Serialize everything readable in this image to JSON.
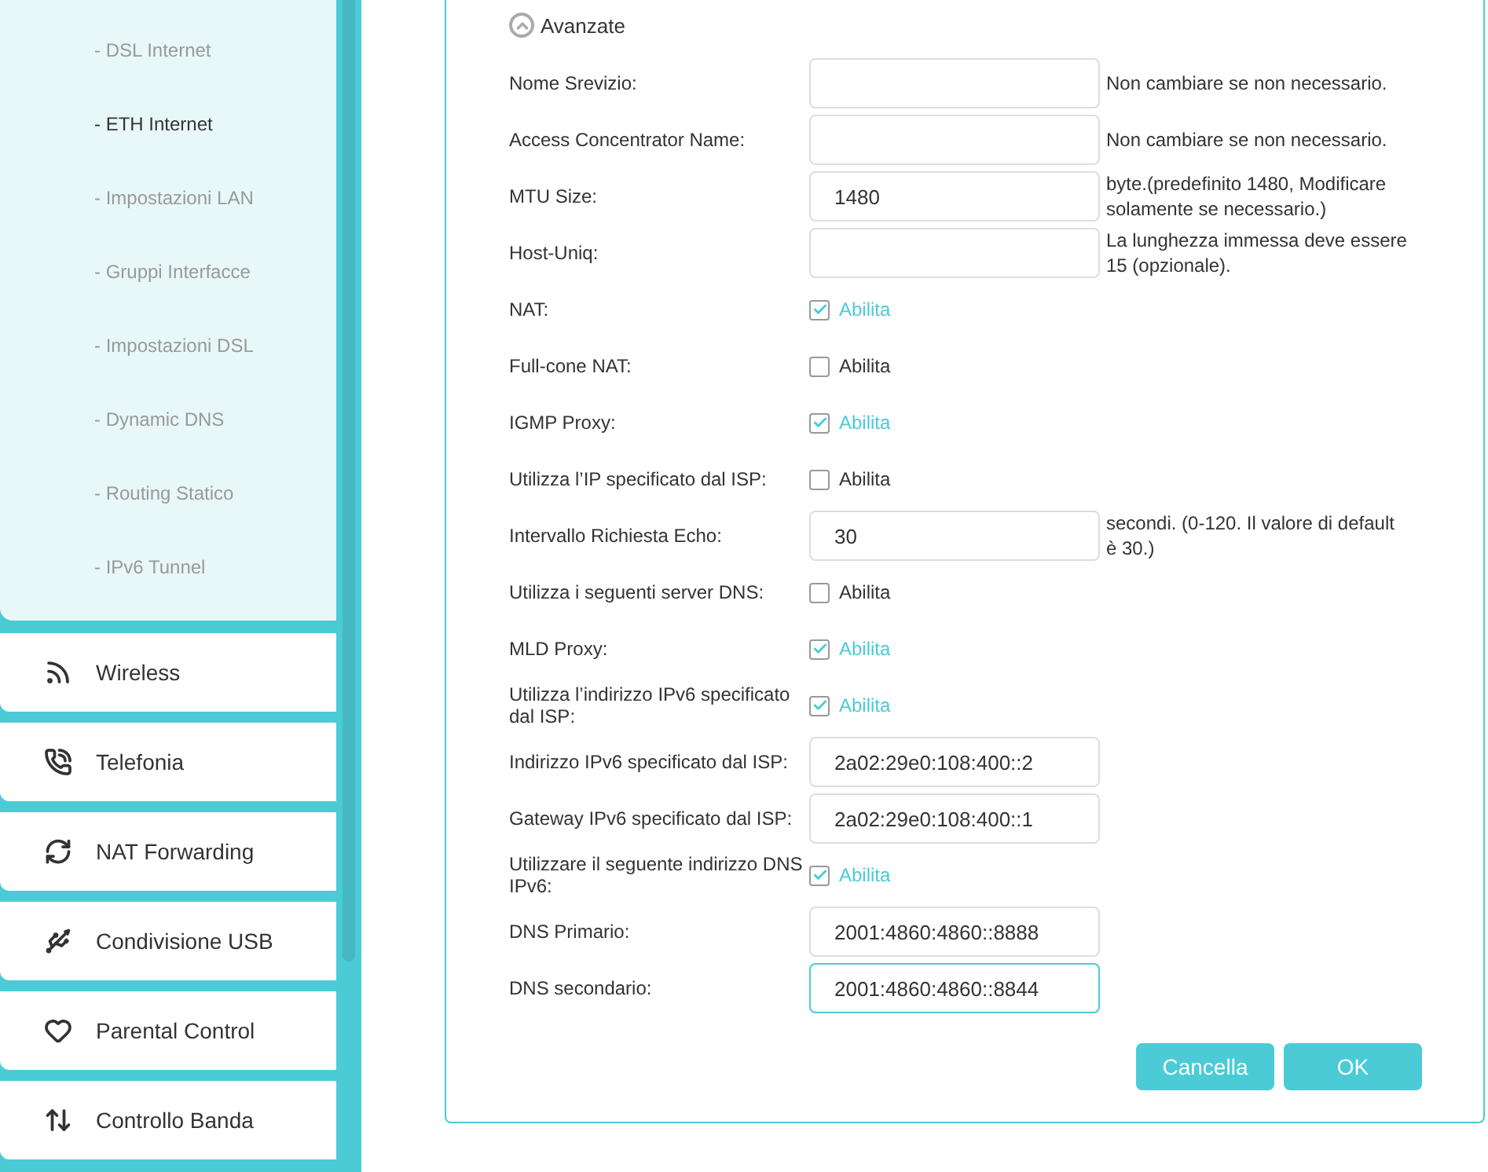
{
  "sidebar": {
    "submenu": [
      {
        "label": "- DSL Internet",
        "selected": false
      },
      {
        "label": "- ETH Internet",
        "selected": true
      },
      {
        "label": "- Impostazioni LAN",
        "selected": false
      },
      {
        "label": "- Gruppi Interfacce",
        "selected": false
      },
      {
        "label": "- Impostazioni DSL",
        "selected": false
      },
      {
        "label": "- Dynamic DNS",
        "selected": false
      },
      {
        "label": "- Routing Statico",
        "selected": false
      },
      {
        "label": "- IPv6 Tunnel",
        "selected": false
      }
    ],
    "menu": [
      {
        "label": "Wireless"
      },
      {
        "label": "Telefonia"
      },
      {
        "label": "NAT Forwarding"
      },
      {
        "label": "Condivisione USB"
      },
      {
        "label": "Parental Control"
      },
      {
        "label": "Controllo Banda"
      }
    ]
  },
  "form": {
    "section": "Avanzate",
    "expanded": true,
    "rows": [
      {
        "kind": "input",
        "label": "Nome Srevizio:",
        "note": "Non cambiare se non necessario.",
        "focused": false
      },
      {
        "kind": "input",
        "label": "Access Concentrator Name:",
        "note": "Non cambiare se non necessario.",
        "focused": false
      },
      {
        "kind": "input",
        "label": "MTU Size:",
        "value": "1480",
        "note": "byte.(predefinito 1480, Modificare solamente se necessario.)",
        "focused": false
      },
      {
        "kind": "input",
        "label": "Host-Uniq:",
        "note": "La lunghezza immessa deve essere 15 (opzionale).",
        "focused": false
      },
      {
        "kind": "checkbox",
        "label": "NAT:",
        "option": "Abilita",
        "checked": true
      },
      {
        "kind": "checkbox",
        "label": "Full-cone NAT:",
        "option": "Abilita",
        "checked": false
      },
      {
        "kind": "checkbox",
        "label": "IGMP Proxy:",
        "option": "Abilita",
        "checked": true
      },
      {
        "kind": "checkbox",
        "label": "Utilizza l’IP specificato dal ISP:",
        "option": "Abilita",
        "checked": false
      },
      {
        "kind": "input",
        "label": "Intervallo Richiesta Echo:",
        "value": "30",
        "note": "secondi. (0-120. Il valore di default è 30.)",
        "focused": false
      },
      {
        "kind": "checkbox",
        "label": "Utilizza i seguenti server DNS:",
        "option": "Abilita",
        "checked": false
      },
      {
        "kind": "checkbox",
        "label": "MLD Proxy:",
        "option": "Abilita",
        "checked": true
      },
      {
        "kind": "checkbox",
        "label": "Utilizza l’indirizzo IPv6 specificato dal ISP:",
        "option": "Abilita",
        "checked": true
      },
      {
        "kind": "input",
        "label": "Indirizzo IPv6 specificato dal ISP:",
        "value": "2a02:29e0:108:400::2",
        "focused": false
      },
      {
        "kind": "input",
        "label": "Gateway IPv6 specificato dal ISP:",
        "value": "2a02:29e0:108:400::1",
        "focused": false
      },
      {
        "kind": "checkbox",
        "label": "Utilizzare il seguente indirizzo DNS IPv6:",
        "option": "Abilita",
        "checked": true
      },
      {
        "kind": "input",
        "label": "DNS Primario:",
        "value": "2001:4860:4860::8888",
        "focused": false
      },
      {
        "kind": "input",
        "label": "DNS secondario:",
        "value": "2001:4860:4860::8844",
        "focused": true
      }
    ],
    "buttons": [
      "Cancella",
      "OK"
    ]
  }
}
